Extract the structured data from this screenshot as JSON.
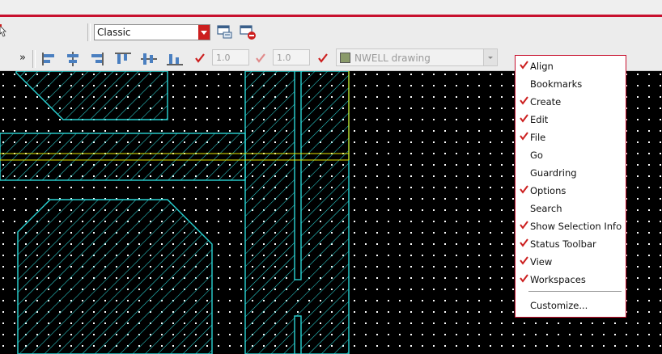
{
  "toolbar1": {
    "workspace": "Classic",
    "icons": [
      "cursor-icon",
      "workspace-save-icon",
      "workspace-delete-icon"
    ]
  },
  "toolbar2": {
    "overflow": "»",
    "align_icons": [
      "align-left-icon",
      "align-hcenter-icon",
      "align-right-icon",
      "align-top-icon",
      "align-vcenter-icon",
      "align-bottom-icon"
    ],
    "value1": "1.0",
    "value2": "1.0",
    "layer": "NWELL drawing",
    "colors": {
      "check": "#cc1f1f",
      "check_disabled": "#e08a8a"
    }
  },
  "canvas": {
    "background": "#000000",
    "shape_color": "#2ad4d4",
    "highlight_color": "#e6e600"
  },
  "menu": {
    "items": [
      {
        "label": "Align",
        "checked": true
      },
      {
        "label": "Bookmarks",
        "checked": false
      },
      {
        "label": "Create",
        "checked": true
      },
      {
        "label": "Edit",
        "checked": true
      },
      {
        "label": "File",
        "checked": true
      },
      {
        "label": "Go",
        "checked": false
      },
      {
        "label": "Guardring",
        "checked": false
      },
      {
        "label": "Options",
        "checked": true
      },
      {
        "label": "Search",
        "checked": false
      },
      {
        "label": "Show Selection Info",
        "checked": true
      },
      {
        "label": "Status Toolbar",
        "checked": true
      },
      {
        "label": "View",
        "checked": true
      },
      {
        "label": "Workspaces",
        "checked": true
      }
    ],
    "customize": "Customize..."
  }
}
